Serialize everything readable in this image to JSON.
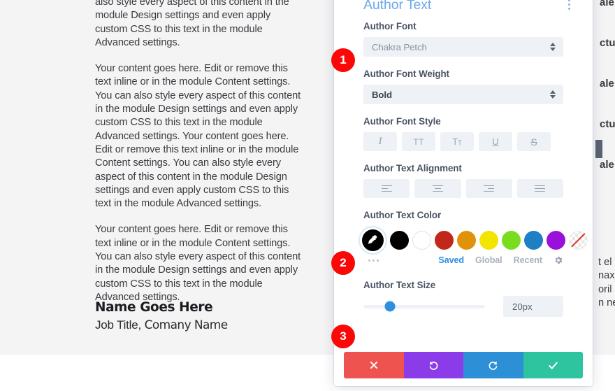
{
  "page": {
    "paragraphs": [
      "also style every aspect of this content in the module Design settings and even apply custom CSS to this text in the module Advanced settings.",
      "Your content goes here. Edit or remove this text inline or in the module Content settings. You can also style every aspect of this content in the module Design settings and even apply custom CSS to this text in the module Advanced settings. Your content goes here. Edit or remove this text inline or in the module Content settings. You can also style every aspect of this content in the module Design settings and even apply custom CSS to this text in the module Advanced settings.",
      "Your content goes here. Edit or remove this text inline or in the module Content settings. You can also style every aspect of this content in the module Design settings and even apply custom CSS to this text in the module Advanced settings."
    ],
    "author_name": "Name Goes Here",
    "author_job_prefix": "Job Title, ",
    "author_company": "Comany Name",
    "right_column_clipped": [
      "ale",
      "ctu",
      "ale",
      "ctu",
      "ale"
    ],
    "right_column_clipped_lower": [
      "t el",
      "nax",
      "oril",
      "n ne"
    ]
  },
  "modal": {
    "title": "Author Text",
    "kebab_icon": "kebab-menu-icon",
    "fields": {
      "font": {
        "label": "Author Font",
        "value": "Chakra Petch"
      },
      "font_weight": {
        "label": "Author Font Weight",
        "value": "Bold"
      },
      "font_style": {
        "label": "Author Font Style",
        "buttons": [
          {
            "name": "italic",
            "glyph": "I"
          },
          {
            "name": "uppercase",
            "glyph": "TT"
          },
          {
            "name": "small-caps",
            "glyph": "T"
          },
          {
            "name": "underline",
            "glyph": "U"
          },
          {
            "name": "strikethrough",
            "glyph": "S"
          }
        ]
      },
      "text_alignment": {
        "label": "Author Text Alignment",
        "buttons": [
          "left",
          "center",
          "right",
          "justify"
        ]
      },
      "text_color": {
        "label": "Author Text Color",
        "eyedropper_icon": "eyedropper-icon",
        "selected_swatch": "eyedropper",
        "swatches": [
          {
            "name": "black",
            "hex": "#000000"
          },
          {
            "name": "white",
            "hex": "#FFFFFF"
          },
          {
            "name": "dark-red",
            "hex": "#C0281C"
          },
          {
            "name": "orange",
            "hex": "#E0930A"
          },
          {
            "name": "yellow",
            "hex": "#F2E500"
          },
          {
            "name": "green",
            "hex": "#77DD1D"
          },
          {
            "name": "blue",
            "hex": "#1D7FC4"
          },
          {
            "name": "purple",
            "hex": "#9A0FD9"
          },
          {
            "name": "transparent",
            "hex": "transparent"
          }
        ],
        "more_icon": "ellipsis-icon",
        "tabs": [
          {
            "label": "Saved",
            "active": true
          },
          {
            "label": "Global",
            "active": false
          },
          {
            "label": "Recent",
            "active": false
          }
        ],
        "settings_icon": "gear-icon"
      },
      "text_size": {
        "label": "Author Text Size",
        "value": "20px",
        "slider_percent": 22
      }
    },
    "actions": [
      {
        "name": "cancel",
        "icon": "close-icon",
        "color": "#EF5350"
      },
      {
        "name": "undo",
        "icon": "undo-icon",
        "color": "#8B3CE8"
      },
      {
        "name": "redo",
        "icon": "redo-icon",
        "color": "#2D8FD5"
      },
      {
        "name": "save",
        "icon": "check-icon",
        "color": "#2EC4A0"
      }
    ]
  },
  "annotations": {
    "badges": [
      {
        "number": "1"
      },
      {
        "number": "2"
      },
      {
        "number": "3"
      }
    ]
  }
}
